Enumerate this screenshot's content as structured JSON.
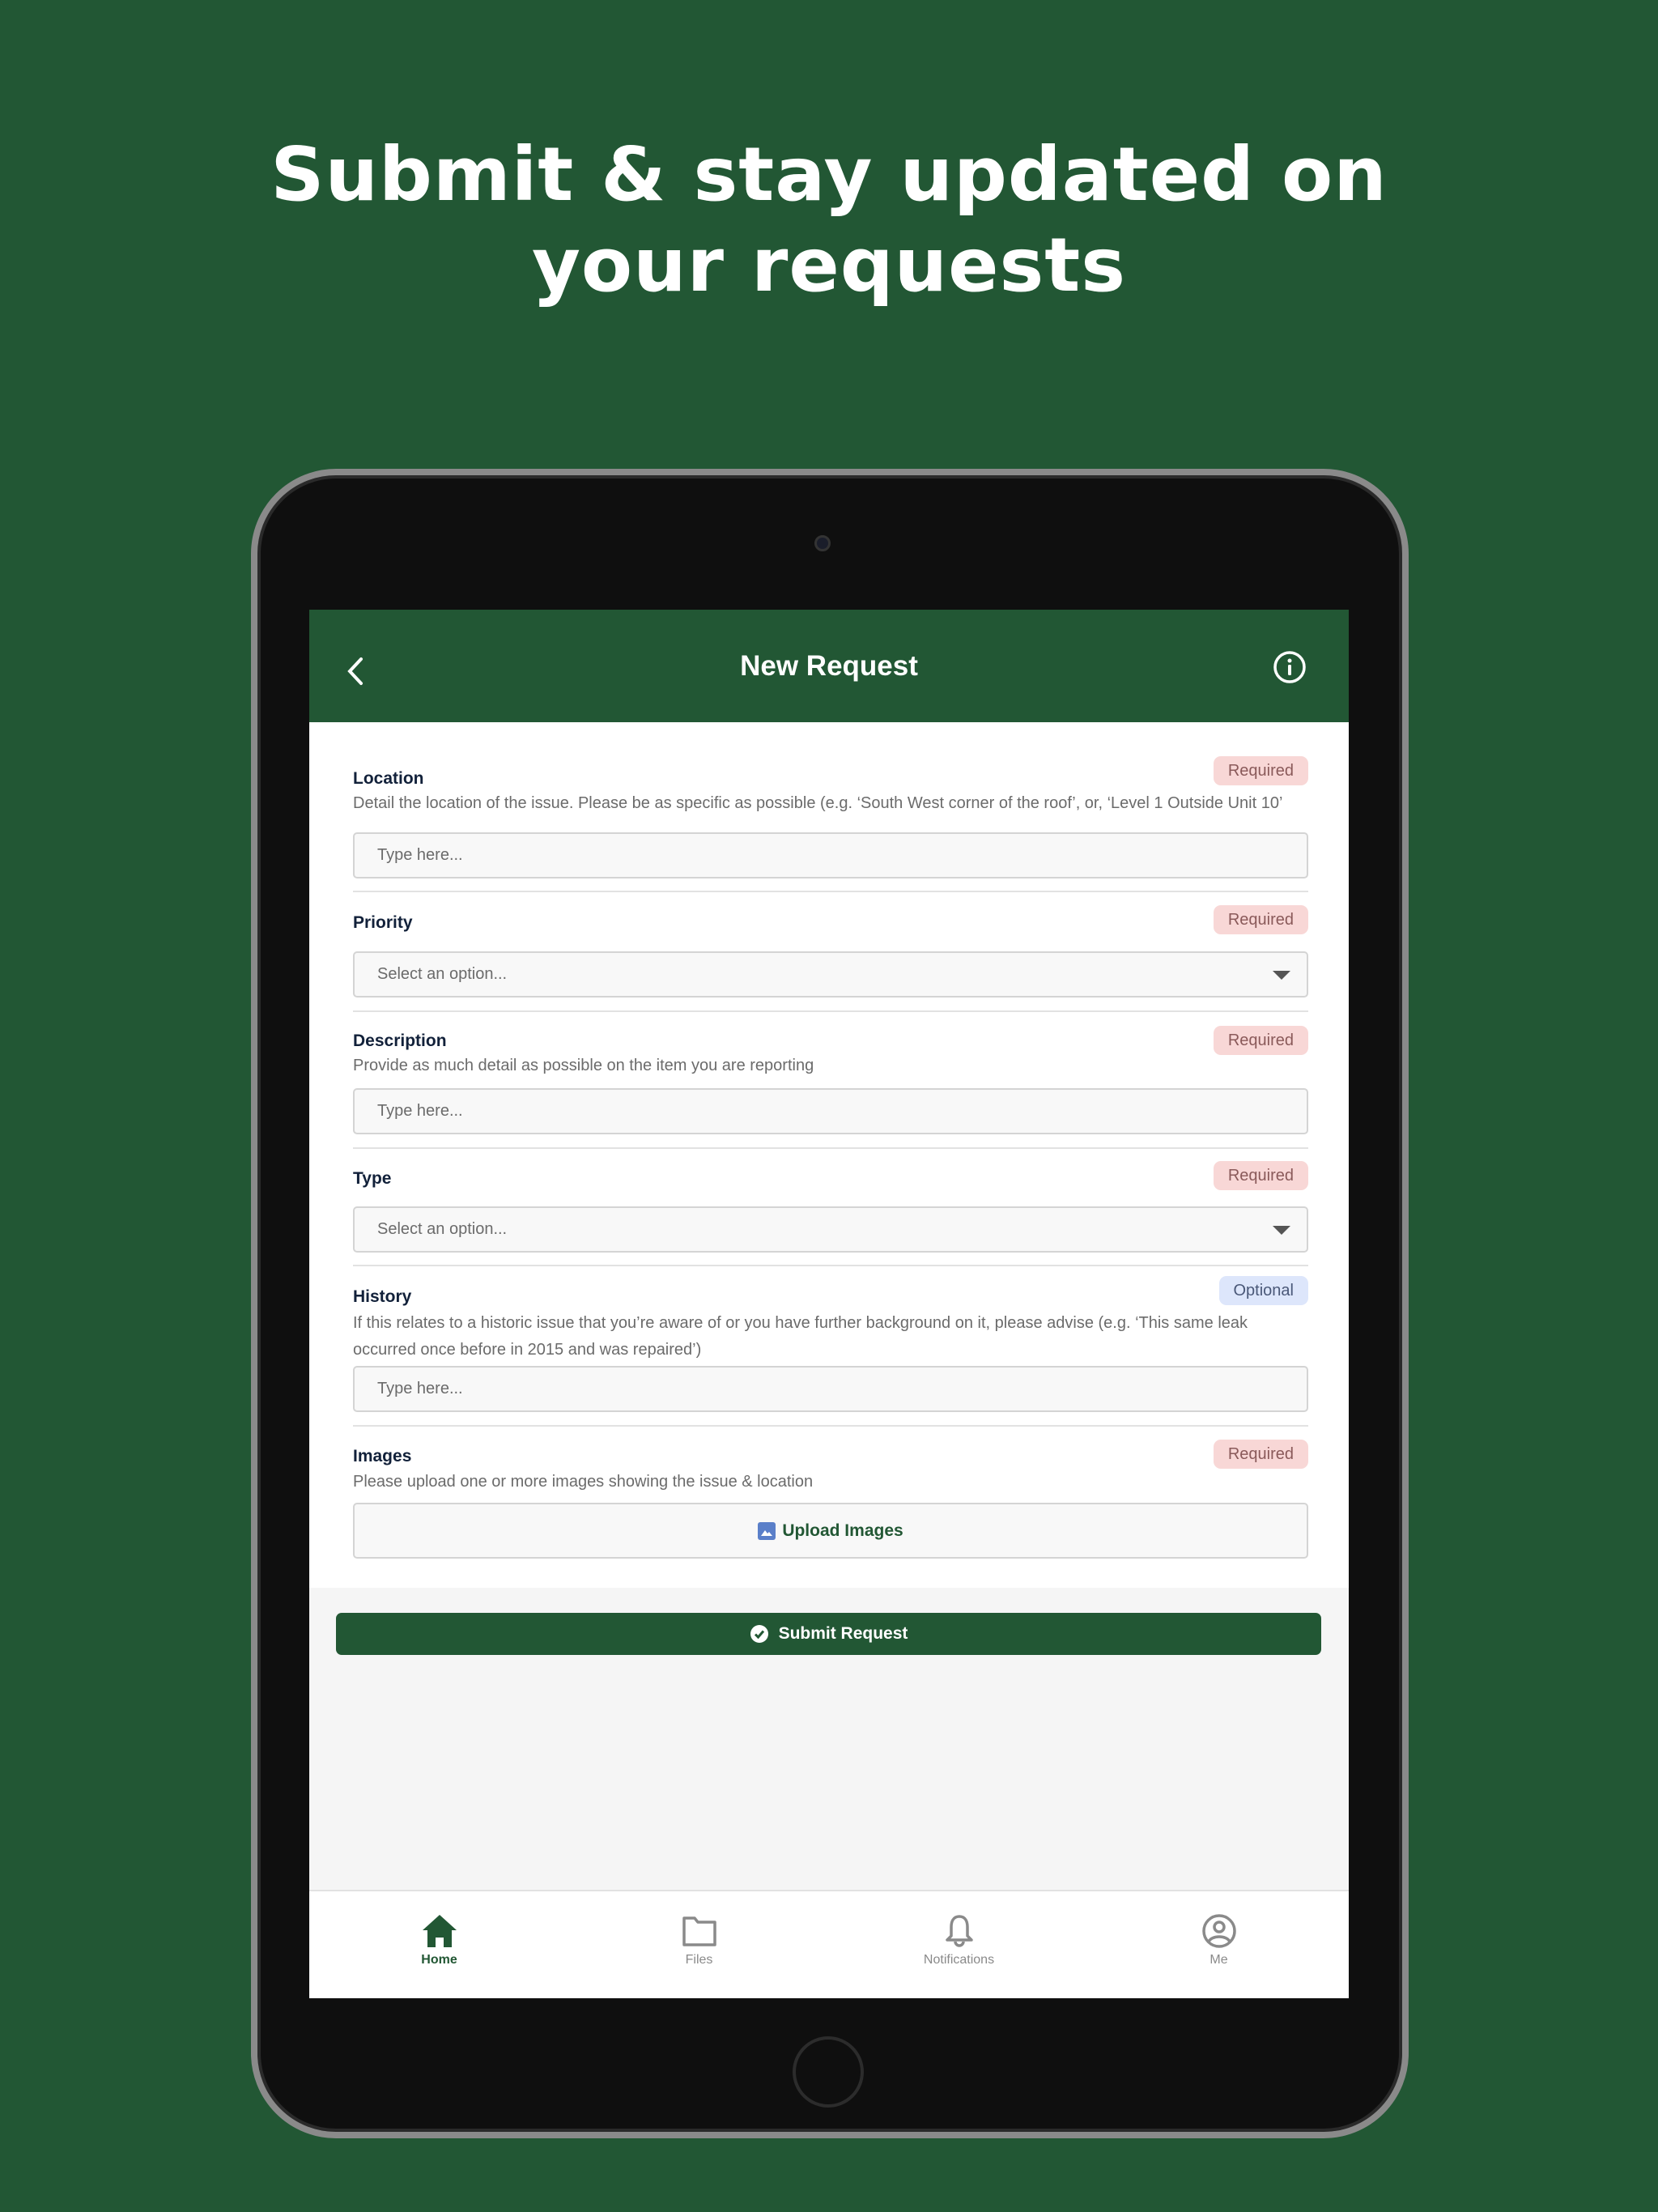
{
  "headline": {
    "line1": "Submit & stay updated on",
    "line2": "your requests"
  },
  "colors": {
    "brand": "#225734",
    "required_bg": "#f8d7d6",
    "optional_bg": "#dde6fb"
  },
  "header": {
    "title": "New Request",
    "back_icon": "chevron-left-icon",
    "info_icon": "info-circle-icon"
  },
  "form": {
    "location": {
      "label": "Location",
      "badge": "Required",
      "description": "Detail the location of the issue. Please be as specific as possible (e.g. ‘South West corner of the roof’, or, ‘Level 1 Outside Unit 10’",
      "placeholder": "Type here..."
    },
    "priority": {
      "label": "Priority",
      "badge": "Required",
      "placeholder": "Select an option..."
    },
    "description": {
      "label": "Description",
      "badge": "Required",
      "description": "Provide as much detail as possible on the item you are reporting",
      "placeholder": "Type here..."
    },
    "type": {
      "label": "Type",
      "badge": "Required",
      "placeholder": "Select an option..."
    },
    "history": {
      "label": "History",
      "badge": "Optional",
      "description": "If this relates to a historic issue that you’re aware of or you have further background on it, please advise (e.g. ‘This same leak occurred once before in 2015 and was repaired’)",
      "placeholder": "Type here..."
    },
    "images": {
      "label": "Images",
      "badge": "Required",
      "description": "Please upload one or more images showing the issue & location",
      "button": "Upload Images"
    }
  },
  "submit": {
    "label": "Submit Request"
  },
  "nav": [
    {
      "label": "Home",
      "icon": "home-icon",
      "active": true
    },
    {
      "label": "Files",
      "icon": "folder-icon"
    },
    {
      "label": "Notifications",
      "icon": "bell-icon"
    },
    {
      "label": "Me",
      "icon": "user-circle-icon"
    }
  ]
}
